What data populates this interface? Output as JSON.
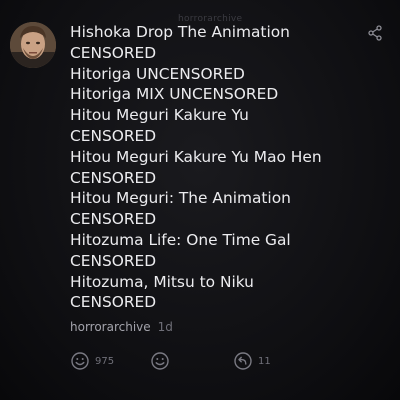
{
  "watermark": "horrorarchive",
  "post": {
    "lines": [
      "Hishoka Drop The Animation",
      "CENSORED",
      "Hitoriga UNCENSORED",
      "Hitoriga MIX UNCENSORED",
      "Hitou Meguri Kakure Yu",
      "CENSORED",
      "Hitou Meguri Kakure Yu Mao Hen",
      "CENSORED",
      "Hitou Meguri: The Animation",
      "CENSORED",
      "Hitozuma Life: One Time Gal",
      "CENSORED",
      "Hitozuma, Mitsu to Niku",
      "CENSORED"
    ],
    "author": "horrorarchive",
    "age": "1d"
  },
  "actions": {
    "likes": "975",
    "replies": "11"
  },
  "icons": {
    "share": "share-icon",
    "like": "smile-like-icon",
    "react": "smile-add-icon",
    "reply": "reply-icon"
  },
  "colors": {
    "background": "#0c0c0e",
    "text": "#ececef",
    "muted": "#a3a3ab"
  }
}
